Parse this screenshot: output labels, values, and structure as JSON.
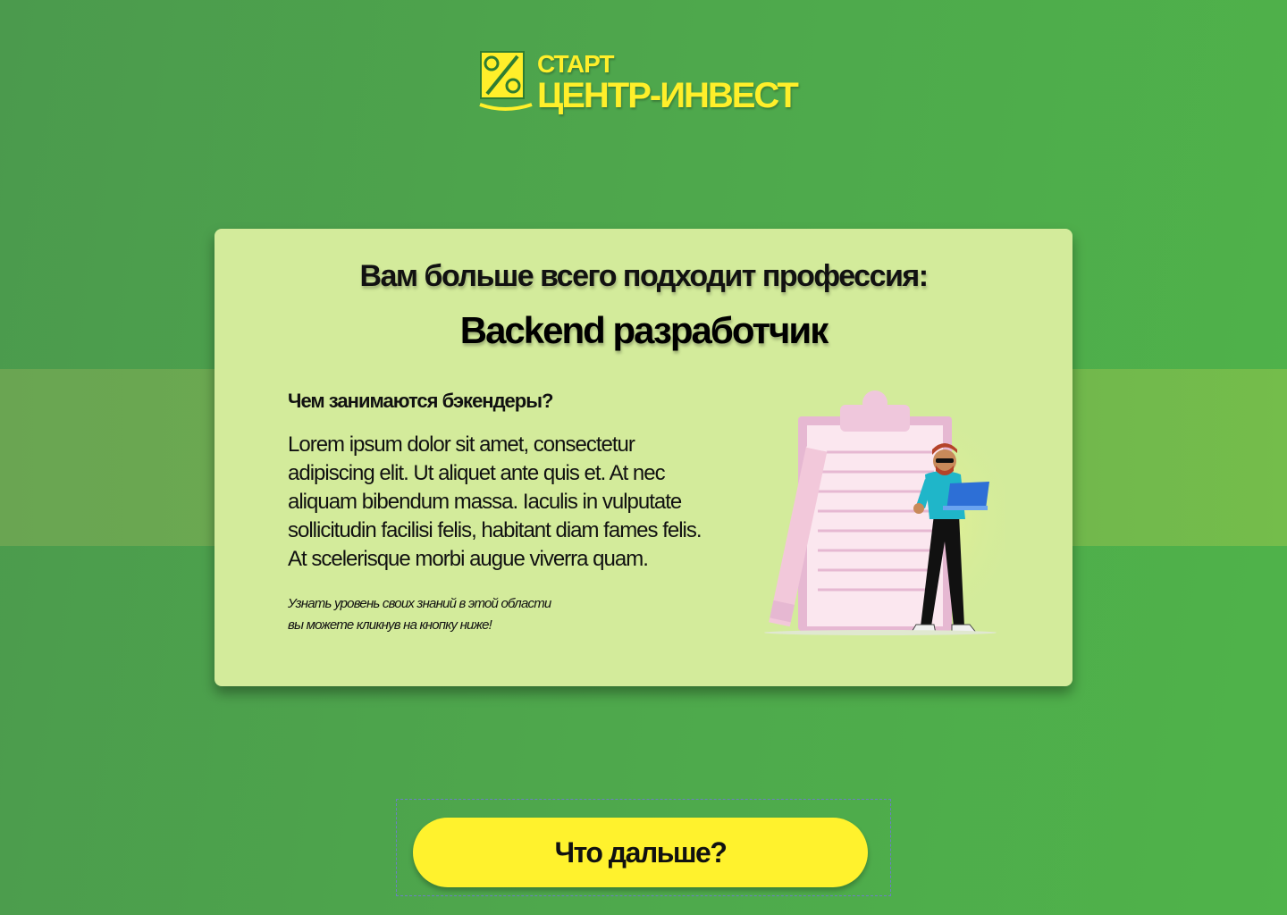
{
  "brand": {
    "line1": "СТАРТ",
    "line2": "ЦЕНТР-ИНВЕСТ",
    "logo_icon": "percent-coin-icon",
    "color": "#ffef2a"
  },
  "result": {
    "subtitle": "Вам больше всего подходит профессия:",
    "profession": "Backend разработчик",
    "question": "Чем занимаются бэкендеры?",
    "description": "Lorem ipsum dolor sit amet, consectetur adipiscing elit. Ut aliquet ante quis et. At nec aliquam bibendum massa. Iaculis in vulputate sollicitudin facilisi felis, habitant diam fames felis. At scelerisque morbi augue viverra quam.",
    "hint_line1": "Узнать уровень своих знаний в этой области",
    "hint_line2": "вы можете кликнув на кнопку ниже!",
    "illustration": "developer-with-laptop-clipboard-illustration"
  },
  "actions": {
    "next_label": "Что дальше?",
    "next_color": "#fff22d"
  },
  "colors": {
    "background": "#4ea84c",
    "card": "#d3eb9b"
  }
}
